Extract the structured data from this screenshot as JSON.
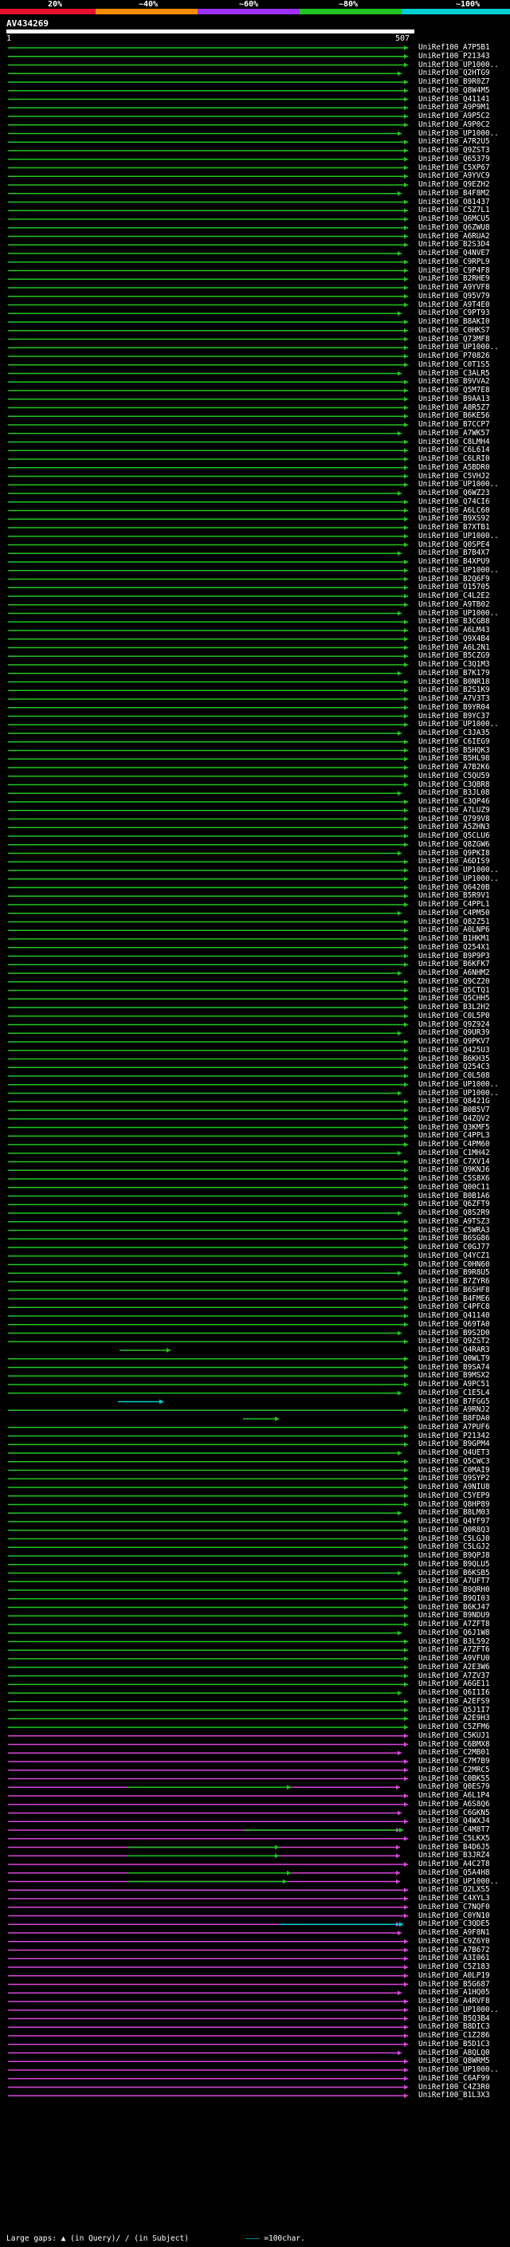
{
  "legend": {
    "labels": [
      "20%",
      "~40%",
      "~60%",
      "~80%",
      "~100%"
    ],
    "colors": [
      "#e8112d",
      "#ff8c00",
      "#9b30ff",
      "#22c422",
      "#00ced1"
    ]
  },
  "query": {
    "name": "AV434269",
    "start": "1",
    "end": "507"
  },
  "hits": [
    "UniRef100_A7P5B1",
    "UniRef100_P21343",
    "UniRef100_UP1000..",
    "UniRef100_Q2HTG9",
    "UniRef100_B9R0Z7",
    "UniRef100_Q8W4M5",
    "UniRef100_Q41141",
    "UniRef100_A9P9M1",
    "UniRef100_A9P5C2",
    "UniRef100_A9P0C2",
    "UniRef100_UP1000..",
    "UniRef100_A7R2U5",
    "UniRef100_Q9ZST3",
    "UniRef100_Q65379",
    "UniRef100_C5XP67",
    "UniRef100_A9YVC9",
    "UniRef100_Q9EZH2",
    "UniRef100_B4F8M2",
    "UniRef100_O81437",
    "UniRef100_C5Z7L1",
    "UniRef100_Q6MCU5",
    "UniRef100_Q6ZWU8",
    "UniRef100_A6RUA2",
    "UniRef100_B2S3D4",
    "UniRef100_Q4NVE7",
    "UniRef100_C9RPL9",
    "UniRef100_C9P4F8",
    "UniRef100_B2RHE9",
    "UniRef100_A9YVF8",
    "UniRef100_Q95V79",
    "UniRef100_A9T4E0",
    "UniRef100_C9PT93",
    "UniRef100_B8AKI0",
    "UniRef100_C0HKS7",
    "UniRef100_Q73MF8",
    "UniRef100_UP1000..",
    "UniRef100_P70826",
    "UniRef100_C0T1S5",
    "UniRef100_C3ALR5",
    "UniRef100_B9VVA2",
    "UniRef100_Q5M7E8",
    "UniRef100_B9AA13",
    "UniRef100_A8R5Z7",
    "UniRef100_B6KE56",
    "UniRef100_B7CCP7",
    "UniRef100_A7WK57",
    "UniRef100_C8LMH4",
    "UniRef100_C6L614",
    "UniRef100_C6LRI0",
    "UniRef100_A5BDR0",
    "UniRef100_C5VHJ2",
    "UniRef100_UP1000..",
    "UniRef100_Q6WZ23",
    "UniRef100_Q74CI6",
    "UniRef100_A6LC60",
    "UniRef100_B9XS92",
    "UniRef100_B7XTB1",
    "UniRef100_UP1000..",
    "UniRef100_Q0SPE4",
    "UniRef100_B7B4X7",
    "UniRef100_B4XPU9",
    "UniRef100_UP1000..",
    "UniRef100_B2Q6F9",
    "UniRef100_O15705",
    "UniRef100_C4L2E2",
    "UniRef100_A9TB02",
    "UniRef100_UP1000..",
    "UniRef100_B3CGB8",
    "UniRef100_A6LM43",
    "UniRef100_Q9X4B4",
    "UniRef100_A6L2N1",
    "UniRef100_B5CZG9",
    "UniRef100_C3Q1M3",
    "UniRef100_B7K179",
    "UniRef100_B0NR18",
    "UniRef100_B2S1K9",
    "UniRef100_A7V3T3",
    "UniRef100_B9YR04",
    "UniRef100_B9YC37",
    "UniRef100_UP1000..",
    "UniRef100_C3JA35",
    "UniRef100_C6IEG9",
    "UniRef100_B5HQK3",
    "UniRef100_B5HL98",
    "UniRef100_A7B2K6",
    "UniRef100_C5QU59",
    "UniRef100_C3QBR8",
    "UniRef100_B3JL08",
    "UniRef100_C3QP46",
    "UniRef100_A7LUZ9",
    "UniRef100_Q799V8",
    "UniRef100_A5ZHN3",
    "UniRef100_Q5CLU6",
    "UniRef100_Q8ZGW6",
    "UniRef100_Q9PKI8",
    "UniRef100_A6DIS9",
    "UniRef100_UP1000..",
    "UniRef100_UP1000..",
    "UniRef100_Q6420B",
    "UniRef100_B5R9V1",
    "UniRef100_C4PPL1",
    "UniRef100_C4PM50",
    "UniRef100_Q82Z51",
    "UniRef100_A0LNP6",
    "UniRef100_B1HKM1",
    "UniRef100_Q254X1",
    "UniRef100_B9P9P3",
    "UniRef100_B6KFK7",
    "UniRef100_A6NHM2",
    "UniRef100_Q9CZ20",
    "UniRef100_Q5CTQ1",
    "UniRef100_Q5CHH5",
    "UniRef100_B3L2H2",
    "UniRef100_C0L5P0",
    "UniRef100_Q9Z924",
    "UniRef100_Q9UR39",
    "UniRef100_Q9PKV7",
    "UniRef100_Q425U3",
    "UniRef100_B6KH35",
    "UniRef100_Q254C3",
    "UniRef100_C0L508",
    "UniRef100_UP1000..",
    "UniRef100_UP1000..",
    "UniRef100_Q8421G",
    "UniRef100_B0B5V7",
    "UniRef100_Q4ZQV2",
    "UniRef100_Q3KMF5",
    "UniRef100_C4PPL3",
    "UniRef100_C4PM60",
    "UniRef100_C1MH42",
    "UniRef100_C7XV14",
    "UniRef100_Q9KNJ6",
    "UniRef100_C5S8X6",
    "UniRef100_Q00C11",
    "UniRef100_B0B1A6",
    "UniRef100_Q6ZFT9",
    "UniRef100_Q8S2R9",
    "UniRef100_A9TSZ3",
    "UniRef100_C5WRA3",
    "UniRef100_B6SG86",
    "UniRef100_C0GJ77",
    "UniRef100_Q4YCZ1",
    "UniRef100_C0HN60",
    "UniRef100_B9R8U5",
    "UniRef100_B7ZYR6",
    "UniRef100_B6SHF8",
    "UniRef100_B4FME6",
    "UniRef100_C4PFC8",
    "UniRef100_Q41140",
    "UniRef100_Q69TA0",
    "UniRef100_B9S2D0",
    "UniRef100_Q9ZST2",
    "UniRef100_Q4RAR3",
    "UniRef100_Q0WLT9",
    "UniRef100_B9SA74",
    "UniRef100_B9MSX2",
    "UniRef100_A9PC51",
    "UniRef100_C1E5L4",
    "UniRef100_B7FGG5",
    "UniRef100_A9RNJ2",
    "UniRef100_B8FDA0",
    "UniRef100_A7PUF6",
    "UniRef100_P21342",
    "UniRef100_B9GPM4",
    "UniRef100_Q4UET3",
    "UniRef100_Q5CWC3",
    "UniRef100_C0MAI9",
    "UniRef100_Q9SYP2",
    "UniRef100_A9NIU8",
    "UniRef100_C5YEP9",
    "UniRef100_Q8HP89",
    "UniRef100_B8LM03",
    "UniRef100_Q4YF97",
    "UniRef100_Q0R8Q3",
    "UniRef100_C5LGJ0",
    "UniRef100_C5LGJ2",
    "UniRef100_B9QPJ8",
    "UniRef100_B9QLU5",
    "UniRef100_B6KSB5",
    "UniRef100_A7UFT7",
    "UniRef100_B9QRH0",
    "UniRef100_B9QI03",
    "UniRef100_B6KJ47",
    "UniRef100_B9NDU9",
    "UniRef100_A7ZFT8",
    "UniRef100_Q6J1W8",
    "UniRef100_B3L592",
    "UniRef100_A7ZFT6",
    "UniRef100_A9VFU0",
    "UniRef100_A2E3W6",
    "UniRef100_A7ZV37",
    "UniRef100_A6GE11",
    "UniRef100_Q6I1I6",
    "UniRef100_A2EFS9",
    "UniRef100_Q5J1I7",
    "UniRef100_A2E9H3",
    "UniRef100_C5ZFM6",
    "UniRef100_C5KUJ1",
    "UniRef100_C6BMX8",
    "UniRef100_C2MB01",
    "UniRef100_C7M7B9",
    "UniRef100_C2MRC5",
    "UniRef100_C0BK55",
    "UniRef100_Q0ES79",
    "UniRef100_A6L1P4",
    "UniRef100_A6S8Q6",
    "UniRef100_C6GKN5",
    "UniRef100_Q4WXJ4",
    "UniRef100_C4M8T7",
    "UniRef100_C5LKX5",
    "UniRef100_B4D6J5",
    "UniRef100_B3JRZ4",
    "UniRef100_A4C2T8",
    "UniRef100_Q5A4H8",
    "UniRef100_UP1000..",
    "UniRef100_Q2LXS5",
    "UniRef100_C4XYL3",
    "UniRef100_C7NQF0",
    "UniRef100_C0YN10",
    "UniRef100_C3QDE5",
    "UniRef100_A9F8N1",
    "UniRef100_C9Z6Y0",
    "UniRef100_A7B672",
    "UniRef100_A3I061",
    "UniRef100_C5Z183",
    "UniRef100_A0LP19",
    "UniRef100_B5G687",
    "UniRef100_A1HQ05",
    "UniRef100_A4RVF8",
    "UniRef100_UP1000..",
    "UniRef100_B5Q3B4",
    "UniRef100_B8DIC3",
    "UniRef100_C1Z286",
    "UniRef100_B5D1C3",
    "UniRef100_A8QLQ0",
    "UniRef100_Q8WRM5",
    "UniRef100_UP1000..",
    "UniRef100_C6AF99",
    "UniRef100_C4Z3R0",
    "UniRef100_B1L3X3"
  ],
  "footer": {
    "large_gaps_label": "Large gaps:",
    "in_query": "(in Query)/",
    "in_subject": "(in Subject)",
    "scale_label": "=100char."
  }
}
